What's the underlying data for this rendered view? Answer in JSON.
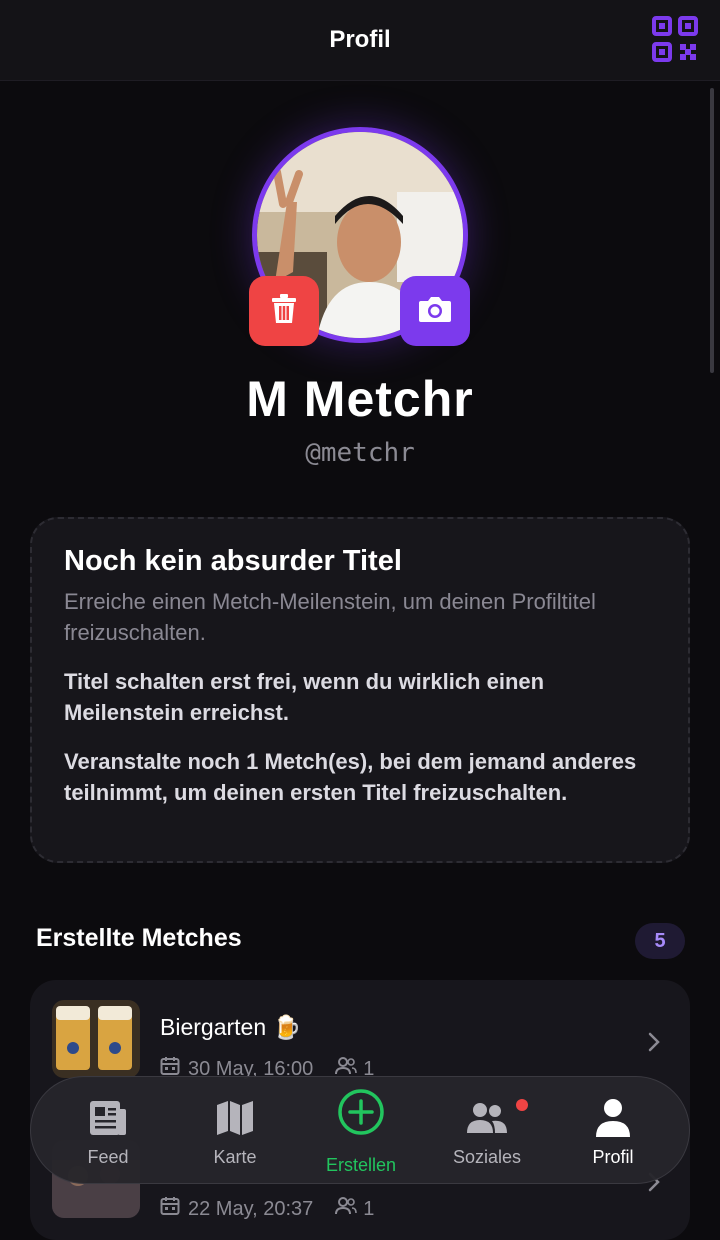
{
  "header": {
    "title": "Profil",
    "qr_icon": "qr-code-icon"
  },
  "profile": {
    "name": "M Metchr",
    "handle": "@metchr",
    "delete_icon": "trash-icon",
    "camera_icon": "camera-icon",
    "accent": "#7c3aed",
    "danger": "#ef4444"
  },
  "title_card": {
    "heading": "Noch kein absurder Titel",
    "subtitle": "Erreiche einen Metch-Meilenstein, um deinen Profiltitel freizuschalten.",
    "para1": "Titel schalten erst frei, wenn du wirklich einen Meilenstein erreichst.",
    "para2": "Veranstalte noch 1 Metch(es), bei dem jemand anderes teilnimmt, um deinen ersten Titel freizuschalten."
  },
  "created": {
    "title": "Erstellte Metches",
    "count": "5",
    "items": [
      {
        "name": "Biergarten 🍺",
        "date": "30 May, 16:00",
        "participants": "1"
      },
      {
        "name": "",
        "date": "22 May, 20:37",
        "participants": "1"
      }
    ]
  },
  "nav": {
    "items": [
      {
        "label": "Feed",
        "icon": "newspaper-icon"
      },
      {
        "label": "Karte",
        "icon": "map-icon"
      },
      {
        "label": "Erstellen",
        "icon": "plus-circle-icon"
      },
      {
        "label": "Soziales",
        "icon": "users-icon"
      },
      {
        "label": "Profil",
        "icon": "user-icon"
      }
    ],
    "active_color": "#22c55e"
  }
}
